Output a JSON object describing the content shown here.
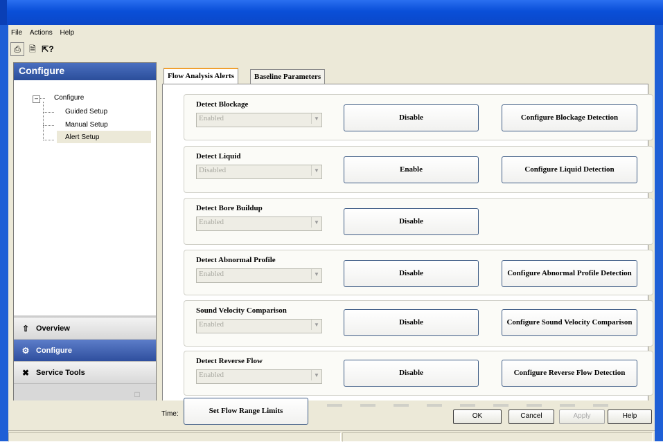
{
  "menu": [
    "File",
    "Actions",
    "Help"
  ],
  "toolbar": {
    "icons": [
      "print-icon",
      "print-preview-icon",
      "whats-this-help-icon"
    ]
  },
  "left_panel": {
    "header": "Configure",
    "tree": {
      "root": "Configure",
      "children": [
        "Guided Setup",
        "Manual Setup",
        "Alert Setup"
      ],
      "selected": "Alert Setup"
    },
    "nav": {
      "overview": "Overview",
      "configure": "Configure",
      "service_tools": "Service Tools"
    }
  },
  "tabs": [
    {
      "label": "Flow Analysis Alerts",
      "active": true
    },
    {
      "label": "Baseline Parameters",
      "active": false
    }
  ],
  "groups": [
    {
      "label": "Detect Blockage",
      "status": "Enabled",
      "toggle": "Disable",
      "config": "Configure Blockage Detection"
    },
    {
      "label": "Detect Liquid",
      "status": "Disabled",
      "toggle": "Enable",
      "config": "Configure Liquid Detection"
    },
    {
      "label": "Detect Bore Buildup",
      "status": "Enabled",
      "toggle": "Disable",
      "config": ""
    },
    {
      "label": "Detect Abnormal Profile",
      "status": "Enabled",
      "toggle": "Disable",
      "config": "Configure Abnormal Profile Detection"
    },
    {
      "label": "Sound Velocity Comparison",
      "status": "Enabled",
      "toggle": "Disable",
      "config": "Configure Sound Velocity Comparison"
    },
    {
      "label": "Detect Reverse Flow",
      "status": "Enabled",
      "toggle": "Disable",
      "config": "Configure Reverse Flow Detection"
    }
  ],
  "bottom": {
    "time_label": "Time:",
    "flow_range_button": "Set Flow Range Limits",
    "ok": "OK",
    "cancel": "Cancel",
    "apply": "Apply",
    "help": "Help"
  },
  "colors": {
    "titlebar": "#0a4fd8",
    "panel_header": "#2b4e9a",
    "tab_accent": "#f0a030",
    "button_border": "#3d5b85"
  }
}
